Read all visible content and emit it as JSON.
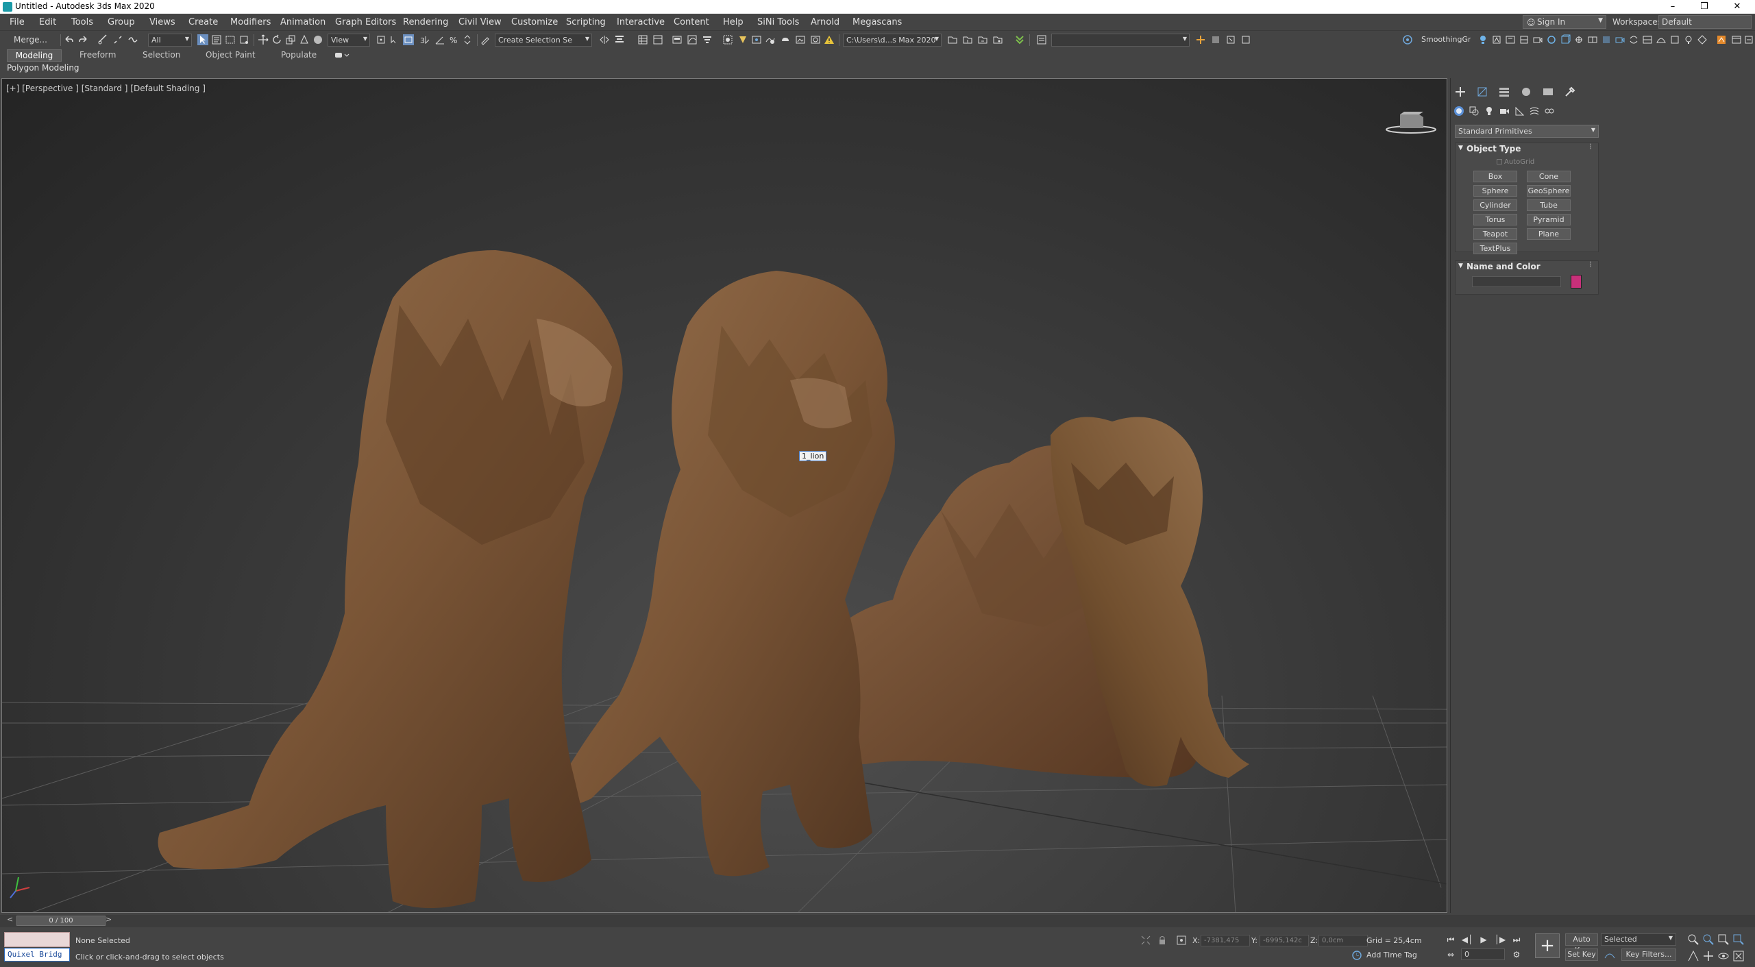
{
  "window": {
    "title": "Untitled - Autodesk 3ds Max 2020",
    "minimize": "–",
    "restore": "❒",
    "close": "✕"
  },
  "menu": {
    "items": [
      "File",
      "Edit",
      "Tools",
      "Group",
      "Views",
      "Create",
      "Modifiers",
      "Animation",
      "Graph Editors",
      "Rendering",
      "Civil View",
      "Customize",
      "Scripting",
      "Interactive",
      "Content",
      "Help",
      "SiNi Tools",
      "Arnold",
      "Megascans"
    ],
    "sign_in": "Sign In",
    "workspaces_label": "Workspaces:",
    "workspace_value": "Default"
  },
  "toolbar": {
    "merge": "Merge...",
    "filter_value": "All",
    "coord_system": "View",
    "selection_set_placeholder": "Create Selection Se",
    "project_path": "C:\\Users\\d...s Max 2020",
    "smoothing": "SmoothingGro"
  },
  "ribbon": {
    "tabs": [
      "Modeling",
      "Freeform",
      "Selection",
      "Object Paint",
      "Populate"
    ],
    "active_tab": "Modeling",
    "panel_label": "Polygon Modeling"
  },
  "viewport": {
    "label": "[+] [Perspective ] [Standard ] [Default Shading ]",
    "object_tag": "1_lion"
  },
  "command_panel": {
    "category": "Standard Primitives",
    "object_type_title": "Object Type",
    "autogrid": "AutoGrid",
    "primitives": [
      "Box",
      "Cone",
      "Sphere",
      "GeoSphere",
      "Cylinder",
      "Tube",
      "Torus",
      "Pyramid",
      "Teapot",
      "Plane",
      "TextPlus"
    ],
    "name_color_title": "Name and Color",
    "object_color": "#c8307a"
  },
  "timeline": {
    "frame_display": "0 / 100"
  },
  "status": {
    "quixel": "Quixel Bridg",
    "selection": "None Selected",
    "prompt": "Click or click-and-drag to select objects",
    "x_label": "X:",
    "x_value": "-7381,475",
    "y_label": "Y:",
    "y_value": "-6995,142c",
    "z_label": "Z:",
    "z_value": "0,0cm",
    "grid": "Grid = 25,4cm",
    "add_time_tag": "Add Time Tag",
    "auto_key": "Auto Key",
    "key_mode": "Selected",
    "set_key": "Set Key",
    "key_filters": "Key Filters...",
    "current_frame": "0"
  },
  "colors": {
    "accent_blue": "#2d6bbf",
    "lion_brown": "#7a5536"
  }
}
